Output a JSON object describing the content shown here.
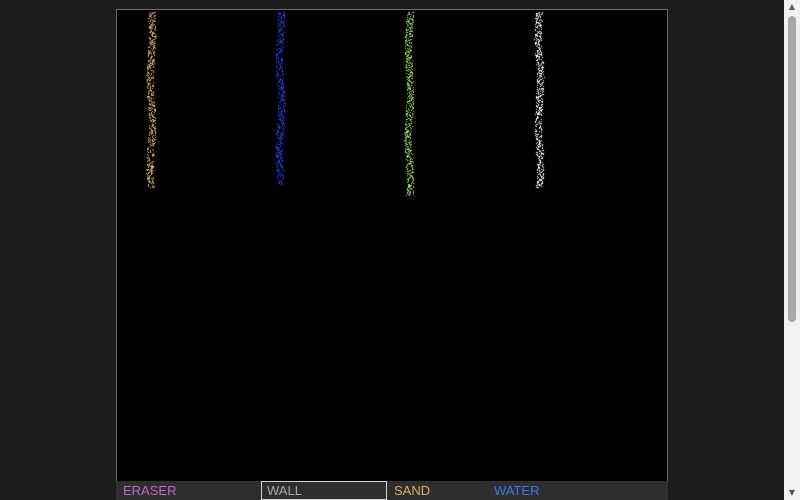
{
  "toolbar": {
    "tools": [
      {
        "label": "ERASER",
        "color": "#c266c8",
        "selected": false
      },
      {
        "label": "WALL",
        "color": "#a8a8a8",
        "selected": true
      },
      {
        "label": "SAND",
        "color": "#d8b45a",
        "selected": false
      },
      {
        "label": "WATER",
        "color": "#3a7ae0",
        "selected": false
      }
    ]
  },
  "scrollbar": {
    "up_arrow": "▲",
    "down_arrow": "▼"
  },
  "canvas": {
    "background": "#000000",
    "particle_streams": [
      {
        "material": "sand",
        "color": "#d8b45a"
      },
      {
        "material": "water",
        "color": "#2a3ad8"
      },
      {
        "material": "plant",
        "color": "#a8e050"
      },
      {
        "material": "salt",
        "color": "#ffffff"
      }
    ]
  }
}
